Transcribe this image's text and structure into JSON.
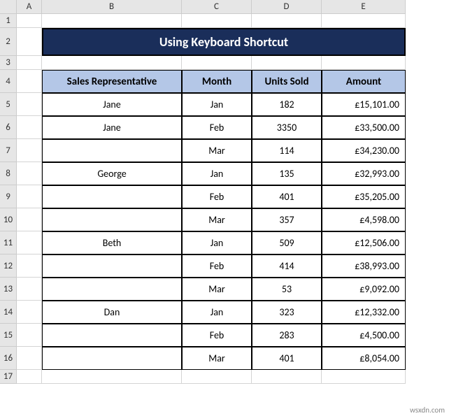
{
  "columns": [
    "",
    "A",
    "B",
    "C",
    "D",
    "E"
  ],
  "row_numbers": [
    "1",
    "2",
    "3",
    "4",
    "5",
    "6",
    "7",
    "8",
    "9",
    "10",
    "11",
    "12",
    "13",
    "14",
    "15",
    "16",
    "17"
  ],
  "title": "Using Keyboard Shortcut",
  "headers": {
    "rep": "Sales Representative",
    "month": "Month",
    "units": "Units Sold",
    "amount": "Amount"
  },
  "rows": [
    {
      "rep": "Jane",
      "month": "Jan",
      "units": "182",
      "amount": "£15,101.00"
    },
    {
      "rep": "Jane",
      "month": "Feb",
      "units": "3350",
      "amount": "£33,500.00"
    },
    {
      "rep": "",
      "month": "Mar",
      "units": "114",
      "amount": "£34,230.00"
    },
    {
      "rep": "George",
      "month": "Jan",
      "units": "135",
      "amount": "£32,993.00"
    },
    {
      "rep": "",
      "month": "Feb",
      "units": "401",
      "amount": "£35,205.00"
    },
    {
      "rep": "",
      "month": "Mar",
      "units": "357",
      "amount": "£4,598.00"
    },
    {
      "rep": "Beth",
      "month": "Jan",
      "units": "509",
      "amount": "£12,506.00"
    },
    {
      "rep": "",
      "month": "Feb",
      "units": "414",
      "amount": "£38,993.00"
    },
    {
      "rep": "",
      "month": "Mar",
      "units": "53",
      "amount": "£9,092.00"
    },
    {
      "rep": "Dan",
      "month": "Jan",
      "units": "323",
      "amount": "£12,332.00"
    },
    {
      "rep": "",
      "month": "Feb",
      "units": "283",
      "amount": "£4,500.00"
    },
    {
      "rep": "",
      "month": "Mar",
      "units": "401",
      "amount": "£8,054.00"
    }
  ],
  "watermark": "wsxdn.com"
}
